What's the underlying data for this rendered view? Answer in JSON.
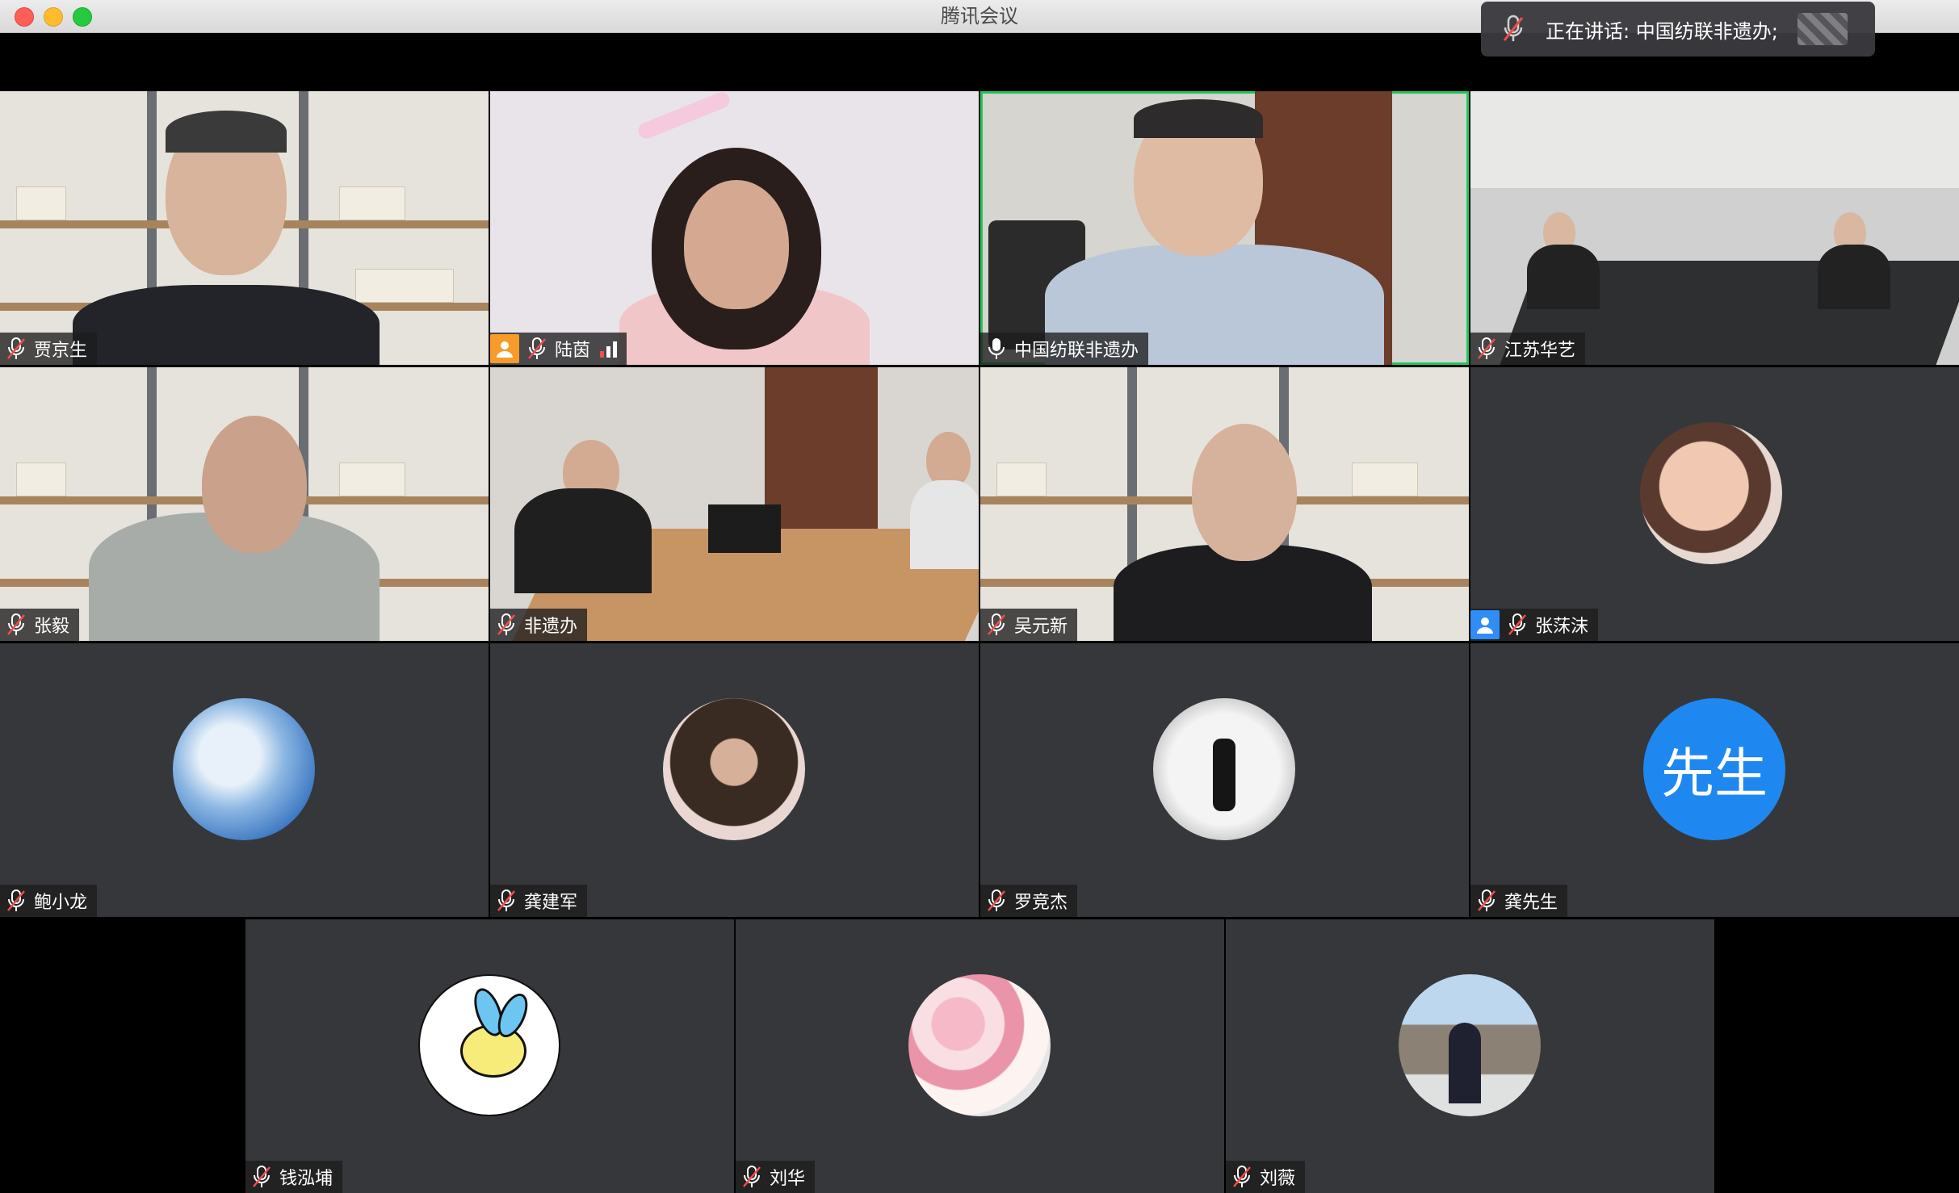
{
  "window": {
    "title": "腾讯会议"
  },
  "speaking": {
    "prefix": "正在讲话:",
    "name": "中国纺联非遗办;"
  },
  "participants": [
    {
      "name": "贾京生",
      "mic": "muted"
    },
    {
      "name": "陆茵",
      "mic": "muted"
    },
    {
      "name": "中国纺联非遗办",
      "mic": "on",
      "active_speaker": true
    },
    {
      "name": "江苏华艺",
      "mic": "muted"
    },
    {
      "name": "张毅",
      "mic": "muted"
    },
    {
      "name": "非遗办",
      "mic": "muted"
    },
    {
      "name": "吴元新",
      "mic": "muted"
    },
    {
      "name": "张莯沫",
      "mic": "muted"
    },
    {
      "name": "鲍小龙",
      "mic": "muted"
    },
    {
      "name": "龚建军",
      "mic": "muted"
    },
    {
      "name": "罗竞杰",
      "mic": "muted"
    },
    {
      "name": "龚先生",
      "mic": "muted",
      "avatar_text": "先生"
    },
    {
      "name": "钱泓埔",
      "mic": "muted"
    },
    {
      "name": "刘华",
      "mic": "muted"
    },
    {
      "name": "刘薇",
      "mic": "muted"
    }
  ],
  "colors": {
    "active_border": "#24c55c",
    "tile_bg": "#36373a",
    "avatar_blue": "#1e88f0",
    "mute_red": "#f24c4c"
  }
}
